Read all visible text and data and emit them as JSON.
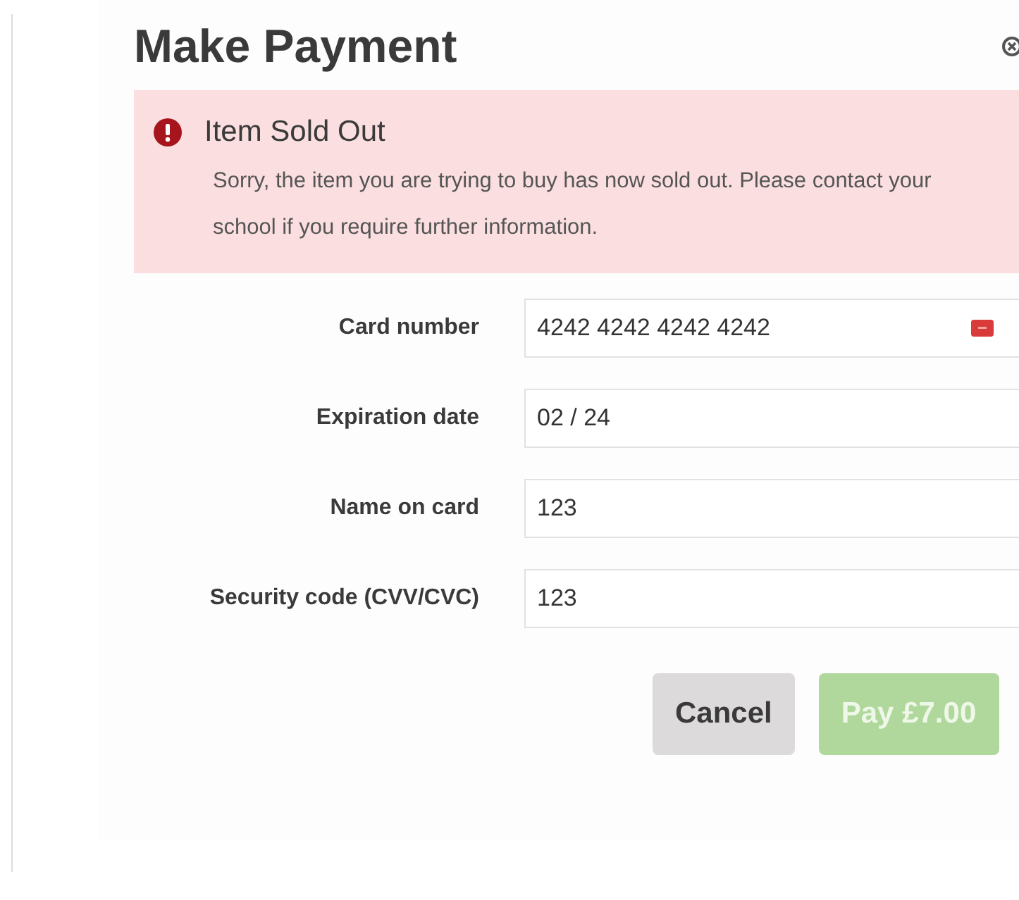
{
  "dialog": {
    "title": "Make Payment"
  },
  "alert": {
    "title": "Item Sold Out",
    "message": "Sorry, the item you are trying to buy has now sold out. Please contact your school if you require further information."
  },
  "fields": [
    {
      "label": "Card number",
      "value": "4242 4242 4242 4242",
      "kind": "card"
    },
    {
      "label": "Expiration date",
      "value": "02 / 24",
      "kind": "text"
    },
    {
      "label": "Name on card",
      "value": "123",
      "kind": "text"
    },
    {
      "label": "Security code (CVV/CVC)",
      "value": "123",
      "kind": "text"
    }
  ],
  "buttons": [
    {
      "label": "Cancel",
      "kind": "secondary",
      "disabled": false
    },
    {
      "label": "Pay £7.00",
      "kind": "primary",
      "disabled": true
    }
  ]
}
